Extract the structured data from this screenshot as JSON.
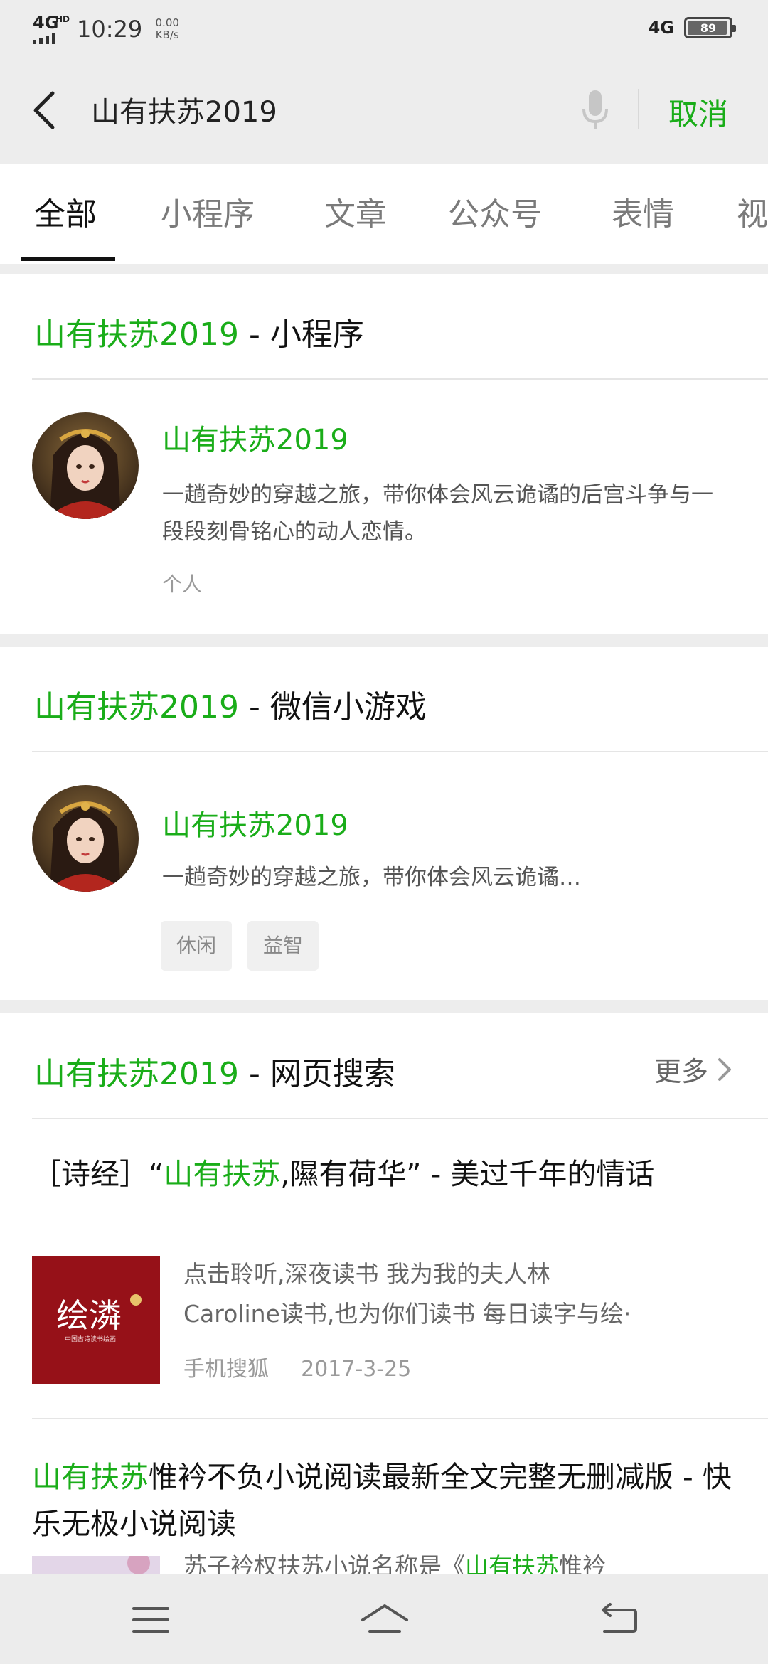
{
  "status_bar": {
    "network": "4G",
    "network_sup": "HD",
    "time": "10:29",
    "speed_value": "0.00",
    "speed_unit": "KB/s",
    "network_right": "4G",
    "battery": "89",
    "battery_level": 0.89
  },
  "search": {
    "query": "山有扶苏2019",
    "cancel_label": "取消"
  },
  "tabs": [
    "全部",
    "小程序",
    "文章",
    "公众号",
    "表情",
    "视"
  ],
  "miniprogram_card": {
    "title_highlight": "山有扶苏2019",
    "title_suffix": " - 小程序",
    "name": "山有扶苏2019",
    "desc": "一趟奇妙的穿越之旅，带你体会风云诡谲的后宫斗争与一段段刻骨铭心的动人恋情。",
    "meta": "个人"
  },
  "minigame_card": {
    "title_highlight": "山有扶苏2019",
    "title_suffix": " - 微信小游戏",
    "name": "山有扶苏2019",
    "desc": "一趟奇妙的穿越之旅，带你体会风云诡谲…",
    "tags": [
      "休闲",
      "益智"
    ]
  },
  "web_card": {
    "title_highlight": "山有扶苏2019",
    "title_suffix": " - 网页搜索",
    "more_label": "更多",
    "results": [
      {
        "title_pre": "［诗经］“",
        "title_highlight": "山有扶苏",
        "title_post": ",隰有荷华” - 美过千年的情话",
        "snippet_line1": "点击聆听,深夜读书 我为我的夫人林",
        "snippet_line2": "Caroline读书,也为你们读书 每日读字与绘·",
        "thumb_text": "绘潾",
        "thumb_sub": "中国古诗读书绘画",
        "source": "手机搜狐",
        "date": "2017-3-25"
      },
      {
        "title_highlight": "山有扶苏",
        "title_post": "惟衿不负小说阅读最新全文完整无删减版 - 快乐无极小说阅读",
        "snippet_pre": "苏子衿权扶苏小说名称是《",
        "snippet_highlight": "山有扶苏",
        "snippet_post": "惟衿"
      }
    ]
  },
  "colors": {
    "accent": "#1aad19",
    "background": "#ededed",
    "card": "#ffffff"
  },
  "icons": {
    "back": "chevron-left-icon",
    "mic": "microphone-icon",
    "more": "chevron-right-icon",
    "nav_menu": "menu-icon",
    "nav_home": "home-icon",
    "nav_back": "return-icon"
  }
}
